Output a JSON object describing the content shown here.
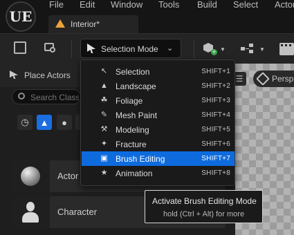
{
  "menubar": {
    "logo": "UE",
    "items": [
      "File",
      "Edit",
      "Window",
      "Tools",
      "Build",
      "Select",
      "Actor"
    ]
  },
  "document_tab": {
    "label": "Interior*",
    "icon": "level-icon"
  },
  "toolbar": {
    "mode_button": {
      "label": "Selection Mode",
      "icon": "selection-cursor-icon",
      "chevron": "⌄"
    }
  },
  "place_actors": {
    "title": "Place Actors",
    "search_placeholder": "Search Classes",
    "category_icons": [
      "clock-icon",
      "shapes-icon",
      "lightbulb-icon",
      "cinematic-icon"
    ],
    "actors": [
      {
        "label": "Actor",
        "thumbnail": "sphere"
      },
      {
        "label": "Character",
        "thumbnail": "person"
      }
    ]
  },
  "viewport": {
    "perspective_label": "Persp",
    "menu_icon": "hamburger-icon"
  },
  "mode_menu": {
    "items": [
      {
        "label": "Selection",
        "shortcut": "SHIFT+1",
        "icon": "selection-cursor-icon",
        "glyph": "↖",
        "active": false
      },
      {
        "label": "Landscape",
        "shortcut": "SHIFT+2",
        "icon": "landscape-icon",
        "glyph": "▲",
        "active": false
      },
      {
        "label": "Foliage",
        "shortcut": "SHIFT+3",
        "icon": "foliage-icon",
        "glyph": "☘",
        "active": false
      },
      {
        "label": "Mesh Paint",
        "shortcut": "SHIFT+4",
        "icon": "mesh-paint-icon",
        "glyph": "✎",
        "active": false
      },
      {
        "label": "Modeling",
        "shortcut": "SHIFT+5",
        "icon": "modeling-icon",
        "glyph": "⚒",
        "active": false
      },
      {
        "label": "Fracture",
        "shortcut": "SHIFT+6",
        "icon": "fracture-icon",
        "glyph": "✦",
        "active": false
      },
      {
        "label": "Brush Editing",
        "shortcut": "SHIFT+7",
        "icon": "brush-editing-icon",
        "glyph": "▣",
        "active": true
      },
      {
        "label": "Animation",
        "shortcut": "SHIFT+8",
        "icon": "animation-icon",
        "glyph": "★",
        "active": false
      }
    ]
  },
  "tooltip": {
    "title": "Activate Brush Editing Mode",
    "hint": "hold (Ctrl + Alt) for more"
  },
  "colors": {
    "accent": "#0e6bde",
    "level_tab_icon": "#e8a33d",
    "panel_bg": "#1e1e1e",
    "menu_bg": "#1a1a1a"
  }
}
